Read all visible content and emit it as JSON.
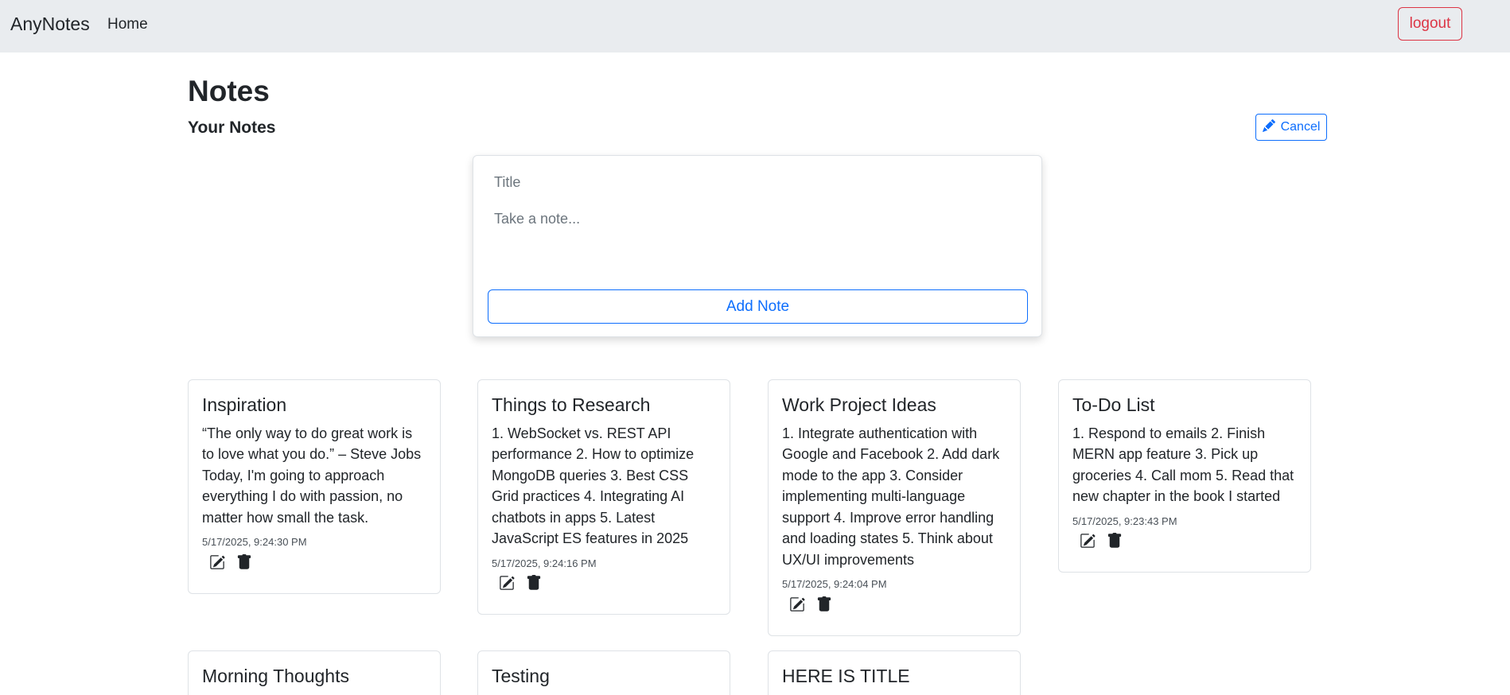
{
  "navbar": {
    "brand": "AnyNotes",
    "home_label": "Home",
    "logout_label": "logout"
  },
  "page": {
    "title": "Notes",
    "section_title": "Your Notes",
    "cancel_label": "Cancel"
  },
  "form": {
    "title_placeholder": "Title",
    "note_placeholder": "Take a note...",
    "add_label": "Add Note"
  },
  "notes": [
    {
      "title": "Inspiration",
      "content": "“The only way to do great work is to love what you do.” – Steve Jobs Today, I'm going to approach everything I do with passion, no matter how small the task.",
      "date": "5/17/2025, 9:24:30 PM"
    },
    {
      "title": "Things to Research",
      "content": "1. WebSocket vs. REST API performance 2. How to optimize MongoDB queries 3. Best CSS Grid practices 4. Integrating AI chatbots in apps 5. Latest JavaScript ES features in 2025",
      "date": "5/17/2025, 9:24:16 PM"
    },
    {
      "title": "Work Project Ideas",
      "content": "1. Integrate authentication with Google and Facebook 2. Add dark mode to the app 3. Consider implementing multi-language support 4. Improve error handling and loading states 5. Think about UX/UI improvements",
      "date": "5/17/2025, 9:24:04 PM"
    },
    {
      "title": "To-Do List",
      "content": "1. Respond to emails 2. Finish MERN app feature 3. Pick up groceries 4. Call mom 5. Read that new chapter in the book I started",
      "date": "5/17/2025, 9:23:43 PM"
    },
    {
      "title": "Morning Thoughts"
    },
    {
      "title": "Testing"
    },
    {
      "title": "HERE IS TITLE"
    }
  ],
  "colors": {
    "navbar_bg": "#e9ecef",
    "primary": "#0d6efd",
    "danger": "#dc3545"
  }
}
